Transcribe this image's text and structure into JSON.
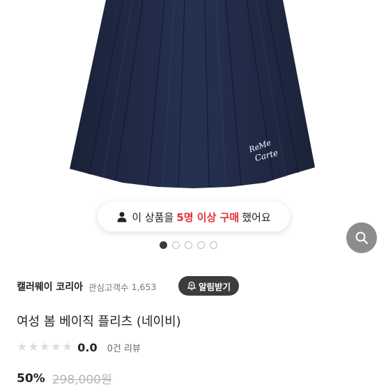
{
  "purchase_banner": {
    "prefix": "이 상품을",
    "highlight": "5명 이상 구매",
    "suffix": "했어요"
  },
  "hero": {
    "logo_text": "ReMeCarte",
    "carousel": {
      "total": 5,
      "active_index": 0
    }
  },
  "store": {
    "name": "캘러웨이 코리아",
    "fans_label": "관심고객수",
    "fans_count": "1,653",
    "alert_button": "알림받기"
  },
  "product": {
    "title": "여성 봄 베이직 플리츠 (네이비)",
    "rating": "0.0",
    "rating_fraction": 0,
    "reviews": "0건 리뷰",
    "discount": "50%",
    "original_price": "298,000원"
  },
  "colors": {
    "skirt_navy": "#202a43",
    "highlight_red": "#e5303a",
    "zoom_button": "#8c8c8c"
  }
}
